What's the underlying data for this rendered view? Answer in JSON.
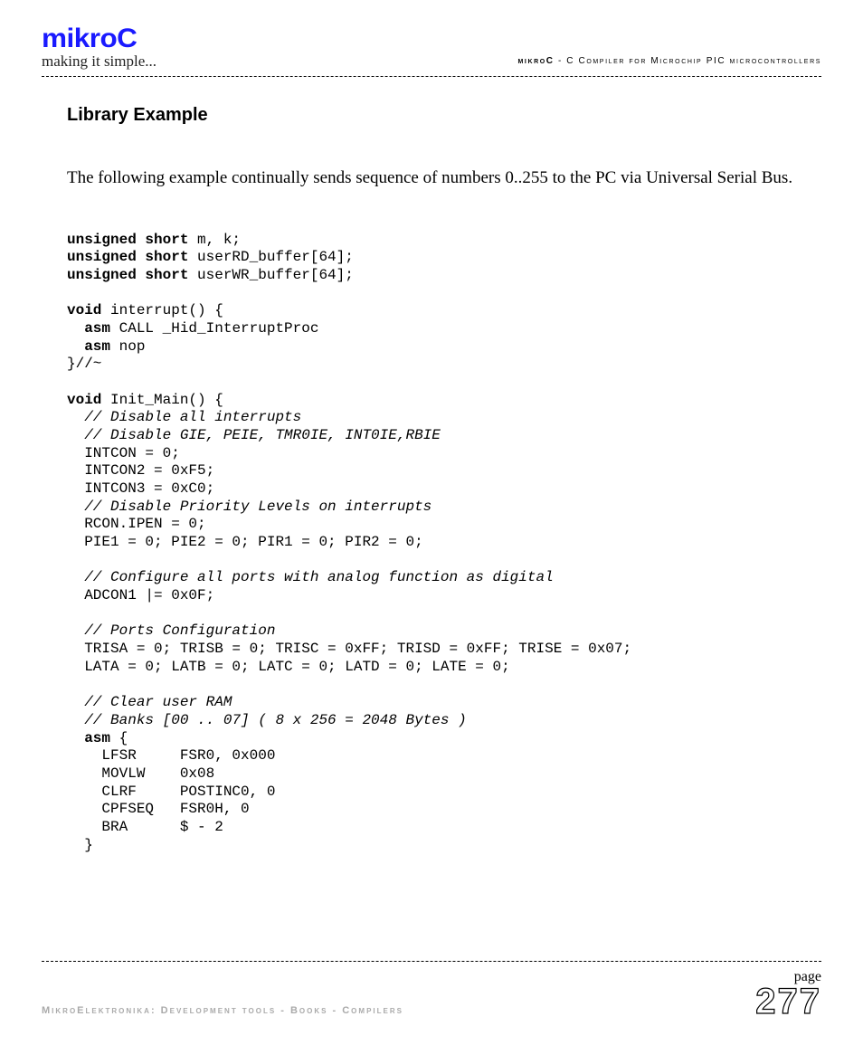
{
  "header": {
    "brand": "mikroC",
    "tagline": "making it simple...",
    "right_bold": "mikroC",
    "right_rest": " - C Compiler for Microchip PIC microcontrollers"
  },
  "body": {
    "section_title": "Library Example",
    "intro": "The following example continually sends sequence of numbers 0..255 to the PC via Universal Serial Bus.",
    "code": {
      "l01a": "unsigned short",
      "l01b": " m, k;",
      "l02a": "unsigned short",
      "l02b": " userRD_buffer[64];",
      "l03a": "unsigned short",
      "l03b": " userWR_buffer[64];",
      "l05a": "void",
      "l05b": " interrupt() {",
      "l06a": "  ",
      "l06b": "asm",
      "l06c": " CALL _Hid_InterruptProc",
      "l07a": "  ",
      "l07b": "asm",
      "l07c": " nop",
      "l08": "}//~",
      "l10a": "void",
      "l10b": " Init_Main() {",
      "l11": "  // Disable all interrupts",
      "l12": "  // Disable GIE, PEIE, TMR0IE, INT0IE,RBIE",
      "l13": "  INTCON = 0;",
      "l14": "  INTCON2 = 0xF5;",
      "l15": "  INTCON3 = 0xC0;",
      "l16": "  // Disable Priority Levels on interrupts",
      "l17": "  RCON.IPEN = 0;",
      "l18": "  PIE1 = 0; PIE2 = 0; PIR1 = 0; PIR2 = 0;",
      "l20": "  // Configure all ports with analog function as digital",
      "l21": "  ADCON1 |= 0x0F;",
      "l23": "  // Ports Configuration",
      "l24": "  TRISA = 0; TRISB = 0; TRISC = 0xFF; TRISD = 0xFF; TRISE = 0x07;",
      "l25": "  LATA = 0; LATB = 0; LATC = 0; LATD = 0; LATE = 0;",
      "l27": "  // Clear user RAM",
      "l28": "  // Banks [00 .. 07] ( 8 x 256 = 2048 Bytes )",
      "l29a": "  ",
      "l29b": "asm",
      "l29c": " {",
      "l30": "    LFSR     FSR0, 0x000",
      "l31": "    MOVLW    0x08",
      "l32": "    CLRF     POSTINC0, 0",
      "l33": "    CPFSEQ   FSR0H, 0",
      "l34": "    BRA      $ - 2",
      "l35": "  }"
    }
  },
  "footer": {
    "left": "MikroElektronika: Development tools - Books - Compilers",
    "page_label": "page",
    "page_num": "277"
  }
}
